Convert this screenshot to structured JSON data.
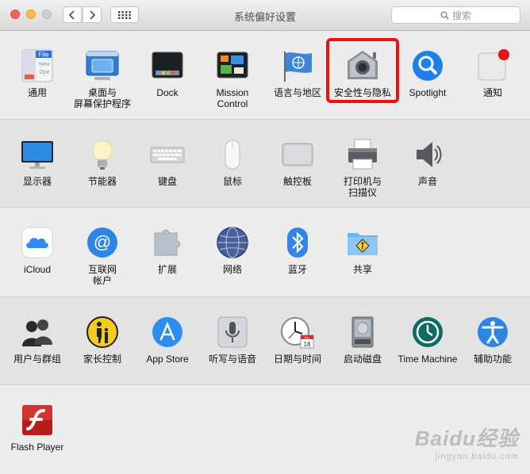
{
  "window": {
    "title": "系统偏好设置"
  },
  "search": {
    "placeholder": "搜索"
  },
  "rows": [
    [
      {
        "label": "通用",
        "icon": "general-icon"
      },
      {
        "label": "桌面与\n屏幕保护程序",
        "icon": "desktop-screensaver-icon"
      },
      {
        "label": "Dock",
        "icon": "dock-icon"
      },
      {
        "label": "Mission\nControl",
        "icon": "mission-control-icon"
      },
      {
        "label": "语言与地区",
        "icon": "language-region-icon"
      },
      {
        "label": "安全性与隐私",
        "icon": "security-privacy-icon"
      },
      {
        "label": "Spotlight",
        "icon": "spotlight-icon"
      },
      {
        "label": "通知",
        "icon": "notifications-icon"
      }
    ],
    [
      {
        "label": "显示器",
        "icon": "displays-icon"
      },
      {
        "label": "节能器",
        "icon": "energy-saver-icon"
      },
      {
        "label": "键盘",
        "icon": "keyboard-icon"
      },
      {
        "label": "鼠标",
        "icon": "mouse-icon"
      },
      {
        "label": "触控板",
        "icon": "trackpad-icon"
      },
      {
        "label": "打印机与\n扫描仪",
        "icon": "printer-scanner-icon"
      },
      {
        "label": "声音",
        "icon": "sound-icon"
      }
    ],
    [
      {
        "label": "iCloud",
        "icon": "icloud-icon"
      },
      {
        "label": "互联网\n帐户",
        "icon": "internet-accounts-icon"
      },
      {
        "label": "扩展",
        "icon": "extensions-icon"
      },
      {
        "label": "网络",
        "icon": "network-icon"
      },
      {
        "label": "蓝牙",
        "icon": "bluetooth-icon"
      },
      {
        "label": "共享",
        "icon": "sharing-icon"
      }
    ],
    [
      {
        "label": "用户与群组",
        "icon": "users-groups-icon"
      },
      {
        "label": "家长控制",
        "icon": "parental-controls-icon"
      },
      {
        "label": "App Store",
        "icon": "app-store-icon"
      },
      {
        "label": "听写与语音",
        "icon": "dictation-speech-icon"
      },
      {
        "label": "日期与时间",
        "icon": "date-time-icon"
      },
      {
        "label": "启动磁盘",
        "icon": "startup-disk-icon"
      },
      {
        "label": "Time Machine",
        "icon": "time-machine-icon"
      },
      {
        "label": "辅助功能",
        "icon": "accessibility-icon"
      }
    ],
    [
      {
        "label": "Flash Player",
        "icon": "flash-player-icon"
      }
    ]
  ],
  "icon_text": {
    "general": [
      "File",
      "New",
      "Ope"
    ],
    "date_month": "JUL",
    "date_day": "18"
  },
  "highlight": {
    "pane": "安全性与隐私",
    "color": "#ee1010"
  },
  "watermark": {
    "brand": "Baidu经验",
    "sub": "jingyan.baidu.com"
  }
}
